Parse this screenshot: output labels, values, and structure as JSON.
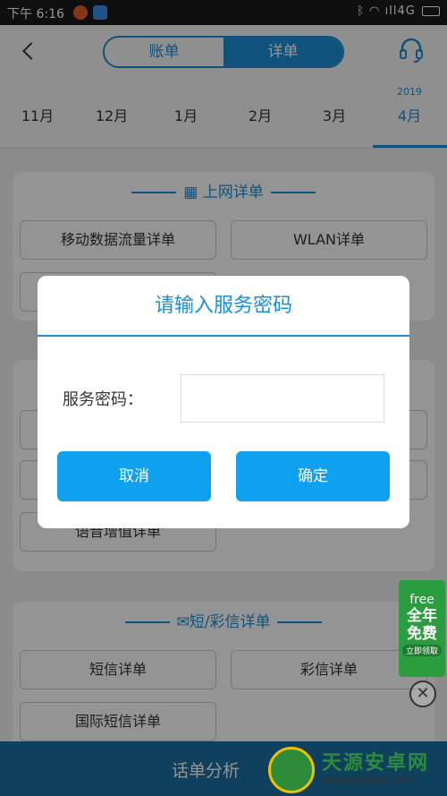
{
  "status_bar": {
    "time": "下午 6:16",
    "network": "4G",
    "right_icons": [
      "bluetooth-icon",
      "wifi-icon",
      "signal-icon"
    ]
  },
  "header": {
    "tabs": [
      "账单",
      "详单"
    ],
    "active_tab": "详单"
  },
  "months": {
    "year": "2019",
    "items": [
      "11月",
      "12月",
      "1月",
      "2月",
      "3月",
      "4月"
    ],
    "active": "4月"
  },
  "sections": {
    "internet": {
      "title": "上网详单",
      "buttons": [
        "移动数据流量详单",
        "WLAN详单"
      ]
    },
    "voice": {
      "buttons": [
        "语音增值详单"
      ]
    },
    "sms": {
      "title": "短/彩信详单",
      "buttons": [
        "短信详单",
        "彩信详单",
        "国际短信详单"
      ]
    }
  },
  "dialog": {
    "title": "请输入服务密码",
    "label": "服务密码：",
    "input_value": "",
    "cancel": "取消",
    "confirm": "确定"
  },
  "bottom_bar": {
    "label": "话单分析"
  },
  "ad": {
    "free": "free",
    "line1": "全年",
    "line2": "免费",
    "small": "立即领取"
  },
  "watermark": {
    "name": "天源安卓网",
    "url": "www.jytyaz.com"
  },
  "colors": {
    "accent": "#1a8fd6",
    "dialog_button": "#0fa0f0",
    "bottom_bar": "#1a6ea3"
  }
}
